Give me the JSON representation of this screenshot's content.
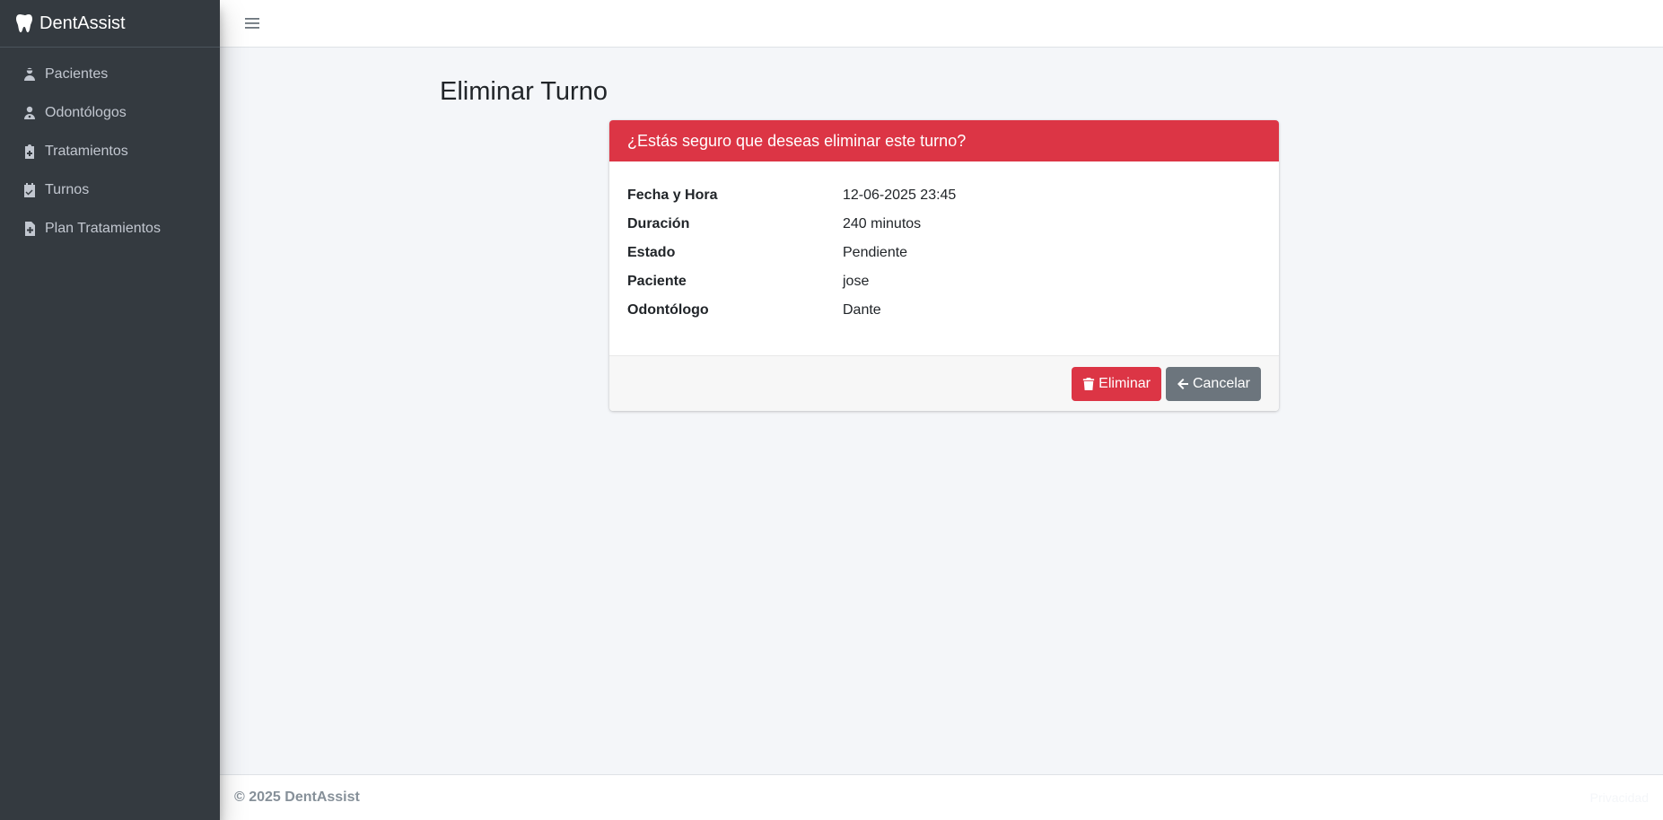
{
  "brand": {
    "name": "DentAssist",
    "logo_icon": "tooth-icon"
  },
  "sidebar": {
    "items": [
      {
        "label": "Pacientes",
        "icon": "user-injured-icon"
      },
      {
        "label": "Odontólogos",
        "icon": "user-doctor-icon"
      },
      {
        "label": "Tratamientos",
        "icon": "clipboard-medical-icon"
      },
      {
        "label": "Turnos",
        "icon": "calendar-check-icon"
      },
      {
        "label": "Plan Tratamientos",
        "icon": "file-medical-icon"
      }
    ]
  },
  "topbar": {
    "menu_icon": "hamburger-icon"
  },
  "page": {
    "title": "Eliminar Turno"
  },
  "card": {
    "header": "¿Estás seguro que deseas eliminar este turno?",
    "fields": [
      {
        "label": "Fecha y Hora",
        "value": "12-06-2025 23:45"
      },
      {
        "label": "Duración",
        "value": "240 minutos"
      },
      {
        "label": "Estado",
        "value": "Pendiente"
      },
      {
        "label": "Paciente",
        "value": "jose"
      },
      {
        "label": "Odontólogo",
        "value": "Dante"
      }
    ],
    "buttons": {
      "delete_label": "Eliminar",
      "cancel_label": "Cancelar"
    }
  },
  "footer": {
    "copyright": "© 2025 DentAssist",
    "privacy": "Privacidad"
  },
  "colors": {
    "sidebar_bg": "#343a40",
    "danger": "#dc3545",
    "secondary": "#6c757d",
    "content_bg": "#f4f6f9"
  }
}
